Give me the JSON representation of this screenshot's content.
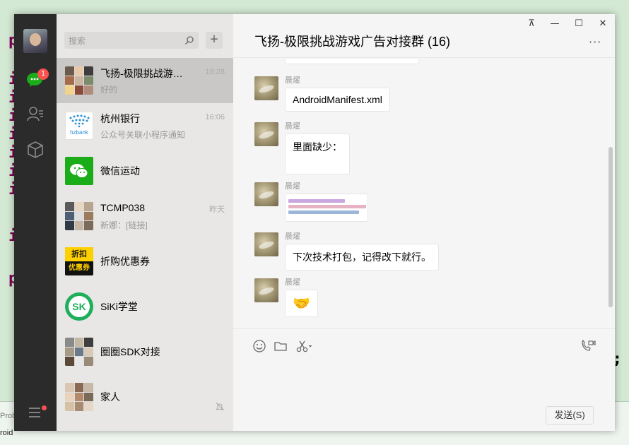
{
  "background": {
    "semicolon": ";",
    "keyword_letters": [
      "p",
      "i",
      "i",
      "i",
      "i",
      "i",
      "i",
      "i",
      "i",
      "p"
    ],
    "bottom_left_1": "Prob",
    "bottom_left_2": "roid"
  },
  "nav": {
    "unread_badge": "1",
    "items": [
      {
        "icon": "chat-bubble-icon",
        "active": true
      },
      {
        "icon": "contacts-icon"
      },
      {
        "icon": "box-icon"
      },
      {
        "icon": "menu-icon"
      }
    ]
  },
  "search": {
    "placeholder": "搜索"
  },
  "add_label": "+",
  "conversations": [
    {
      "name": "飞扬-极限挑战游戏广告对接群",
      "preview": "好的",
      "time": "18:28",
      "selected": true
    },
    {
      "name": "杭州银行",
      "preview": "公众号关联小程序通知",
      "time": "16:06"
    },
    {
      "name": "微信运动",
      "preview": "",
      "time": ""
    },
    {
      "name": "TCMP038",
      "preview": "新娜：[链接]",
      "time": "昨天"
    },
    {
      "name": "折购优惠券",
      "preview": "",
      "time": ""
    },
    {
      "name": "SiKi学堂",
      "preview": "",
      "time": ""
    },
    {
      "name": "圈圈SDK对接",
      "preview": "",
      "time": ""
    },
    {
      "name": "家人",
      "preview": "",
      "time": "",
      "muted": true
    }
  ],
  "logos": {
    "hzbank": "hzbank",
    "zhegou_top": "折扣",
    "zhegou_bottom": "优惠券",
    "siki": "SK"
  },
  "chat": {
    "title": "飞扬-极限挑战游戏广告对接群 (16)",
    "window_controls": [
      "⊼",
      "—",
      "☐",
      "✕"
    ],
    "more": "···",
    "messages": [
      {
        "sender": "晨燿",
        "text": "AndroidManifest.xml"
      },
      {
        "sender": "晨燿",
        "text": "里面缺少："
      },
      {
        "sender": "晨燿",
        "type": "image"
      },
      {
        "sender": "晨燿",
        "text": "下次技术打包，记得改下就行。"
      },
      {
        "sender": "晨燿",
        "type": "emoji",
        "text": "🤝"
      }
    ],
    "send_label": "发送(S)"
  },
  "colors": {
    "nav_bg": "#2b2b2b",
    "list_bg": "#e8e7e6",
    "selected_bg": "#c9c8c6",
    "badge": "#fa5151",
    "wechat_green": "#1aad19"
  }
}
